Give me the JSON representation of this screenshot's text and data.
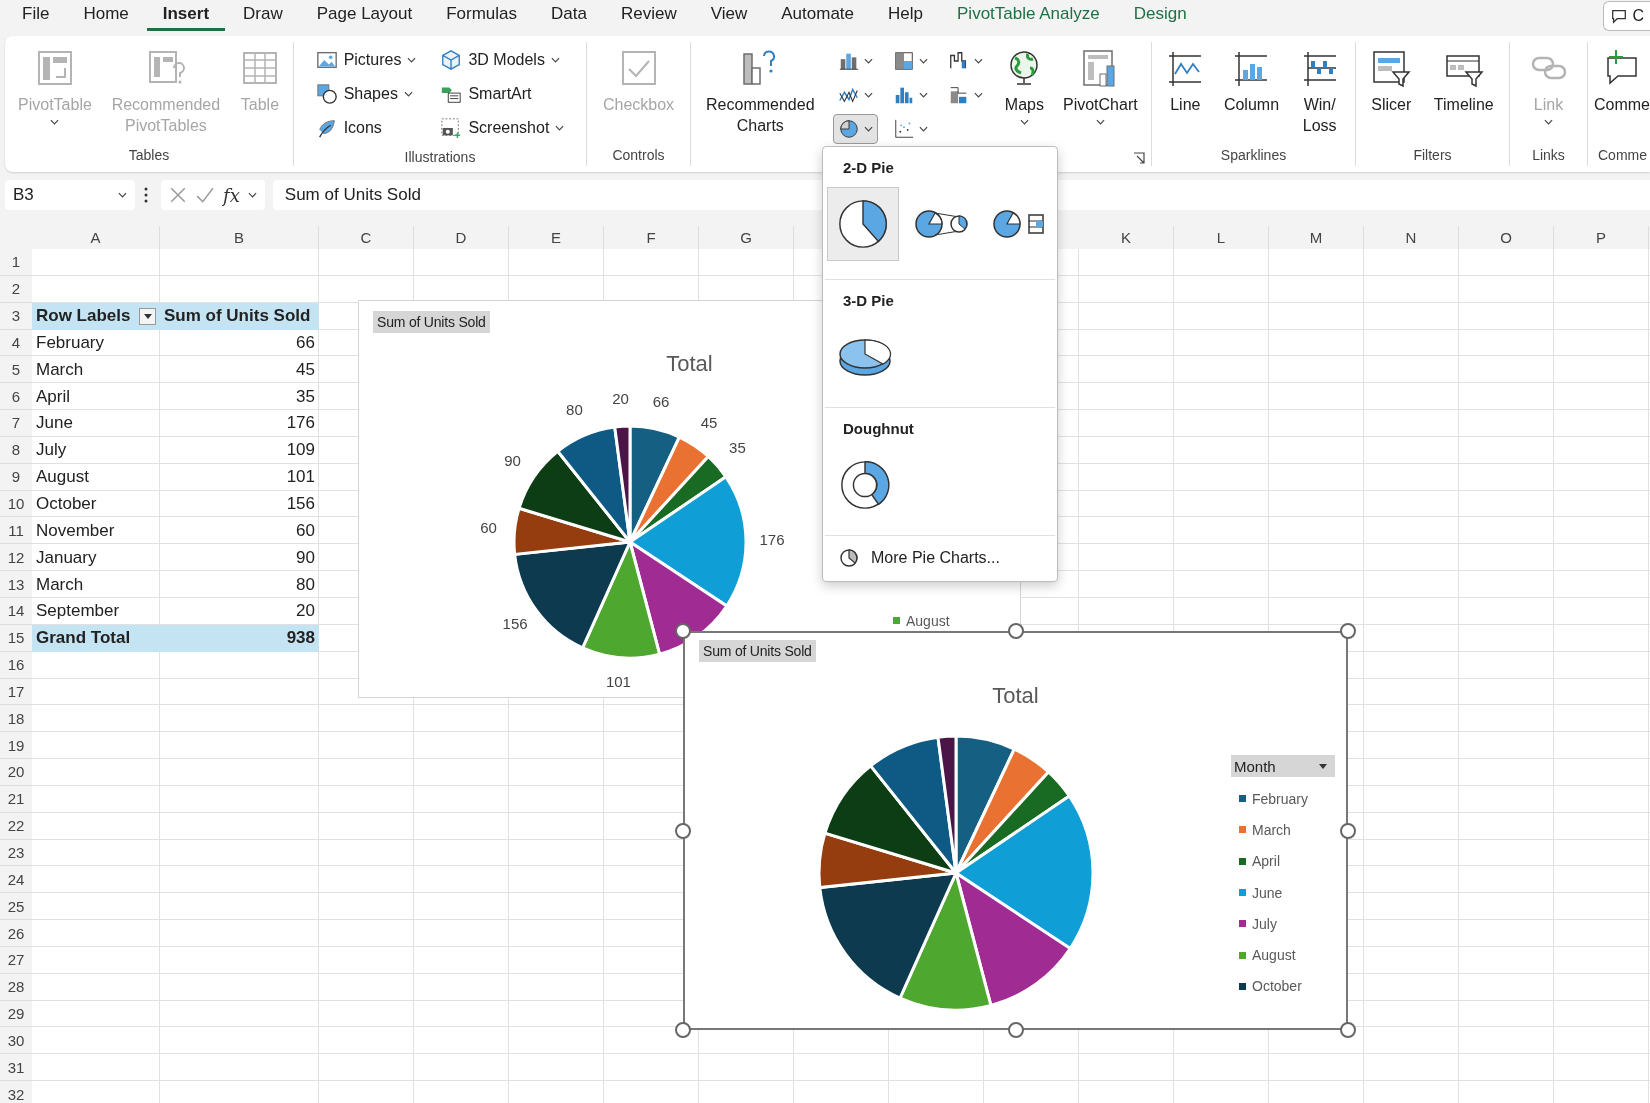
{
  "tabs": [
    {
      "label": "File",
      "selected": false,
      "contextual": false
    },
    {
      "label": "Home",
      "selected": false,
      "contextual": false
    },
    {
      "label": "Insert",
      "selected": true,
      "contextual": false
    },
    {
      "label": "Draw",
      "selected": false,
      "contextual": false
    },
    {
      "label": "Page Layout",
      "selected": false,
      "contextual": false
    },
    {
      "label": "Formulas",
      "selected": false,
      "contextual": false
    },
    {
      "label": "Data",
      "selected": false,
      "contextual": false
    },
    {
      "label": "Review",
      "selected": false,
      "contextual": false
    },
    {
      "label": "View",
      "selected": false,
      "contextual": false
    },
    {
      "label": "Automate",
      "selected": false,
      "contextual": false
    },
    {
      "label": "Help",
      "selected": false,
      "contextual": false
    },
    {
      "label": "PivotTable Analyze",
      "selected": false,
      "contextual": true
    },
    {
      "label": "Design",
      "selected": false,
      "contextual": true
    }
  ],
  "comment_button": {
    "label": "C"
  },
  "ribbon": {
    "groups": [
      {
        "label": "Tables",
        "items": [
          {
            "kind": "large",
            "label": "PivotTable",
            "disabled": true,
            "menu": true
          },
          {
            "kind": "large",
            "label": "Recommended PivotTables",
            "disabled": true,
            "menu": false
          },
          {
            "kind": "large",
            "label": "Table",
            "disabled": true,
            "menu": false
          }
        ]
      },
      {
        "label": "Illustrations",
        "items": [
          {
            "kind": "small",
            "label": "Pictures",
            "disabled": false,
            "menu": true
          },
          {
            "kind": "small",
            "label": "Shapes",
            "disabled": false,
            "menu": true
          },
          {
            "kind": "small",
            "label": "Icons",
            "disabled": false,
            "menu": false
          },
          {
            "kind": "small",
            "label": "3D Models",
            "disabled": false,
            "menu": true
          },
          {
            "kind": "small",
            "label": "SmartArt",
            "disabled": false,
            "menu": false
          },
          {
            "kind": "small",
            "label": "Screenshot",
            "disabled": false,
            "menu": true
          }
        ]
      },
      {
        "label": "Controls",
        "items": [
          {
            "kind": "large",
            "label": "Checkbox",
            "disabled": true,
            "menu": false
          }
        ]
      },
      {
        "launcher": true,
        "items": [
          {
            "kind": "large",
            "label": "Recommended Charts",
            "disabled": false,
            "menu": false
          },
          {
            "kind": "icon",
            "selected": false,
            "menu": true
          },
          {
            "kind": "icon",
            "selected": false,
            "menu": true
          },
          {
            "kind": "icon",
            "selected": true,
            "menu": true
          },
          {
            "kind": "icon",
            "selected": false,
            "menu": true
          },
          {
            "kind": "icon",
            "selected": false,
            "menu": true
          },
          {
            "kind": "icon",
            "selected": false,
            "menu": true
          },
          {
            "kind": "icon",
            "selected": false,
            "menu": true
          },
          {
            "kind": "icon",
            "selected": false,
            "menu": true
          },
          {
            "kind": "large",
            "label": "Maps",
            "disabled": false,
            "menu": true
          },
          {
            "kind": "large",
            "label": "PivotChart",
            "disabled": false,
            "menu": true
          }
        ]
      },
      {
        "label": "Sparklines",
        "items": [
          {
            "kind": "large",
            "label": "Line",
            "disabled": false,
            "menu": false
          },
          {
            "kind": "large",
            "label": "Column",
            "disabled": false,
            "menu": false
          },
          {
            "kind": "large",
            "label": "Win/ Loss",
            "disabled": false,
            "menu": false
          }
        ]
      },
      {
        "label": "Filters",
        "items": [
          {
            "kind": "large",
            "label": "Slicer",
            "disabled": false,
            "menu": false
          },
          {
            "kind": "large",
            "label": "Timeline",
            "disabled": false,
            "menu": false
          }
        ]
      },
      {
        "label": "Links",
        "items": [
          {
            "kind": "large",
            "label": "Link",
            "disabled": true,
            "menu": true
          }
        ]
      },
      {
        "label": "Comme",
        "items": [
          {
            "kind": "large",
            "label": "Comme",
            "disabled": false,
            "menu": false
          }
        ]
      }
    ]
  },
  "formula_bar": {
    "name_box": "B3",
    "function_label": "fx",
    "formula": "Sum of Units Sold"
  },
  "sheet": {
    "columns": [
      "A",
      "B",
      "C",
      "D",
      "E",
      "F",
      "G",
      "K",
      "L",
      "M",
      "N",
      "O",
      "P"
    ],
    "rows": [
      "1",
      "2",
      "3",
      "4",
      "5",
      "6",
      "7",
      "8",
      "9",
      "10",
      "11",
      "12",
      "13",
      "14",
      "15",
      "16",
      "17",
      "18",
      "19",
      "20",
      "21",
      "22",
      "23",
      "24",
      "25",
      "26",
      "27",
      "28",
      "29",
      "30",
      "31",
      "32"
    ]
  },
  "pivot_table": {
    "headers": [
      {
        "label": "Row Labels",
        "filter": true
      },
      {
        "label": "Sum of Units Sold"
      }
    ],
    "rows": [
      {
        "label": "February",
        "value": "66"
      },
      {
        "label": "March",
        "value": "45"
      },
      {
        "label": "April",
        "value": "35"
      },
      {
        "label": "June",
        "value": "176"
      },
      {
        "label": "July",
        "value": "109"
      },
      {
        "label": "August",
        "value": "101"
      },
      {
        "label": "October",
        "value": "156"
      },
      {
        "label": "November",
        "value": "60"
      },
      {
        "label": "January",
        "value": "90"
      },
      {
        "label": "March",
        "value": "80"
      },
      {
        "label": "September",
        "value": "20"
      }
    ],
    "total": {
      "label": "Grand Total",
      "value": "938"
    }
  },
  "charts": [
    {
      "selected": false,
      "chart_data": {
        "type": "pie",
        "title": "Total",
        "series": [
          {
            "name": "Sum of Units Sold",
            "values": [
              7.0,
              4.8,
              3.7,
              18.8,
              11.6,
              10.8,
              16.6,
              6.4,
              9.6,
              8.6,
              2.1
            ]
          }
        ],
        "colors": [
          "#156082",
          "#e97132",
          "#196b24",
          "#0f9ed5",
          "#a02b93",
          "#4ea72e",
          "#0e3a50",
          "#953d0f",
          "#0d3d14",
          "#0e5a85",
          "#4c1548"
        ],
        "value_labels": [
          "66",
          "45",
          "35",
          "176",
          null,
          "101",
          "156",
          "60",
          "90",
          "80",
          "20"
        ]
      },
      "legend": {
        "items": [
          {
            "label": "August",
            "color": "#4ea72e"
          }
        ]
      }
    },
    {
      "selected": true,
      "chart_data": {
        "type": "pie",
        "title": "Total",
        "series": [
          {
            "name": "Sum of Units Sold",
            "values": [
              7.0,
              4.8,
              3.7,
              18.8,
              11.6,
              10.8,
              16.6,
              6.4,
              9.6,
              8.6,
              2.1
            ]
          }
        ],
        "colors": [
          "#156082",
          "#e97132",
          "#196b24",
          "#0f9ed5",
          "#a02b93",
          "#4ea72e",
          "#0e3a50",
          "#953d0f",
          "#0d3d14",
          "#0e5a85",
          "#4c1548"
        ]
      },
      "legend": {
        "header": "Month",
        "items": [
          {
            "label": "February",
            "color": "#156082"
          },
          {
            "label": "March",
            "color": "#e97132"
          },
          {
            "label": "April",
            "color": "#196b24"
          },
          {
            "label": "June",
            "color": "#0f9ed5"
          },
          {
            "label": "July",
            "color": "#a02b93"
          },
          {
            "label": "August",
            "color": "#4ea72e"
          },
          {
            "label": "October",
            "color": "#0e3a50"
          }
        ]
      }
    }
  ],
  "pie_menu": {
    "sections": [
      {
        "title": "2-D Pie",
        "options": [
          {
            "selected": true
          },
          {
            "selected": false
          },
          {
            "selected": false
          }
        ]
      },
      {
        "title": "3-D Pie",
        "options": [
          {
            "selected": false
          }
        ]
      },
      {
        "title": "Doughnut",
        "options": [
          {
            "selected": false
          }
        ]
      }
    ],
    "more": {
      "label": "More Pie Charts..."
    }
  }
}
